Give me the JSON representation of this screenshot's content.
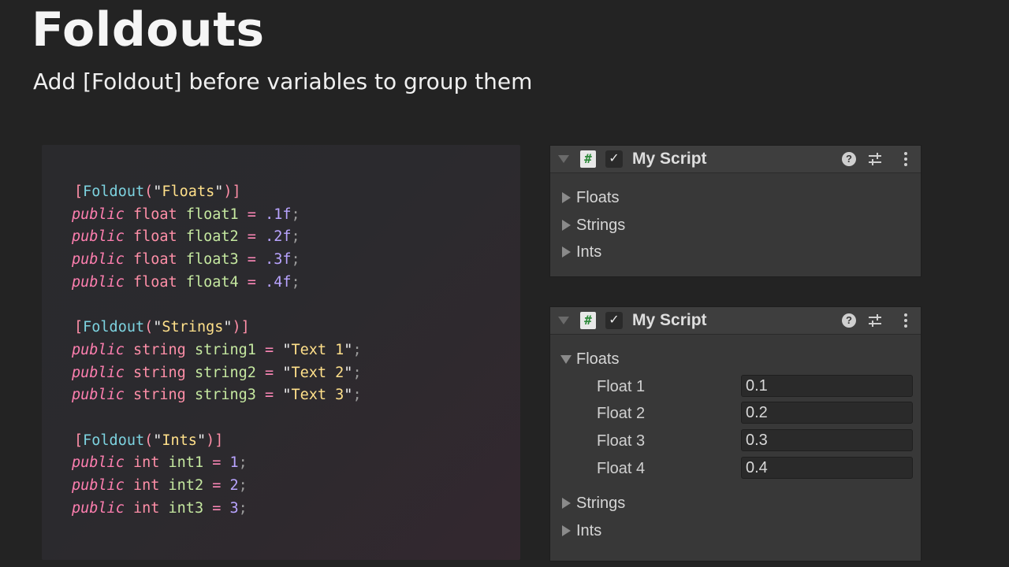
{
  "slide": {
    "title": "Foldouts",
    "subtitle": "Add [Foldout] before variables to group them"
  },
  "code": {
    "groups": [
      {
        "attribute_open": "[",
        "attribute_name": "Foldout",
        "attribute_arg": "Floats",
        "attribute_close": ")]",
        "lines": [
          {
            "mod": "public",
            "type": "float",
            "name": "float1",
            "value": ".1f"
          },
          {
            "mod": "public",
            "type": "float",
            "name": "float2",
            "value": ".2f"
          },
          {
            "mod": "public",
            "type": "float",
            "name": "float3",
            "value": ".3f"
          },
          {
            "mod": "public",
            "type": "float",
            "name": "float4",
            "value": ".4f"
          }
        ]
      },
      {
        "attribute_open": "[",
        "attribute_name": "Foldout",
        "attribute_arg": "Strings",
        "attribute_close": ")]",
        "lines": [
          {
            "mod": "public",
            "type": "string",
            "name": "string1",
            "value": "\"Text 1\""
          },
          {
            "mod": "public",
            "type": "string",
            "name": "string2",
            "value": "\"Text 2\""
          },
          {
            "mod": "public",
            "type": "string",
            "name": "string3",
            "value": "\"Text 3\""
          }
        ]
      },
      {
        "attribute_open": "[",
        "attribute_name": "Foldout",
        "attribute_arg": "Ints",
        "attribute_close": ")]",
        "lines": [
          {
            "mod": "public",
            "type": "int",
            "name": "int1",
            "value": "1"
          },
          {
            "mod": "public",
            "type": "int",
            "name": "int2",
            "value": "2"
          },
          {
            "mod": "public",
            "type": "int",
            "name": "int3",
            "value": "3"
          }
        ]
      }
    ]
  },
  "inspector_collapsed": {
    "title": "My Script",
    "foldouts": [
      "Floats",
      "Strings",
      "Ints"
    ]
  },
  "inspector_expanded": {
    "title": "My Script",
    "open_foldout": "Floats",
    "fields": [
      {
        "label": "Float 1",
        "value": "0.1"
      },
      {
        "label": "Float 2",
        "value": "0.2"
      },
      {
        "label": "Float 3",
        "value": "0.3"
      },
      {
        "label": "Float 4",
        "value": "0.4"
      }
    ],
    "closed_foldouts": [
      "Strings",
      "Ints"
    ]
  },
  "icons": {
    "script": "script-hash-icon",
    "enabled": "checkmark-icon",
    "help": "help-icon",
    "presets": "preset-sliders-icon",
    "menu": "kebab-menu-icon",
    "collapsed": "triangle-right-icon",
    "expanded": "triangle-down-icon"
  },
  "colors": {
    "keyword": "#ff7fb0",
    "identifier": "#c5e8a0",
    "number": "#b9a4ff",
    "attribute": "#7dd3e0",
    "string": "#ffe08a",
    "script_icon_hash": "#2d8a3a"
  }
}
